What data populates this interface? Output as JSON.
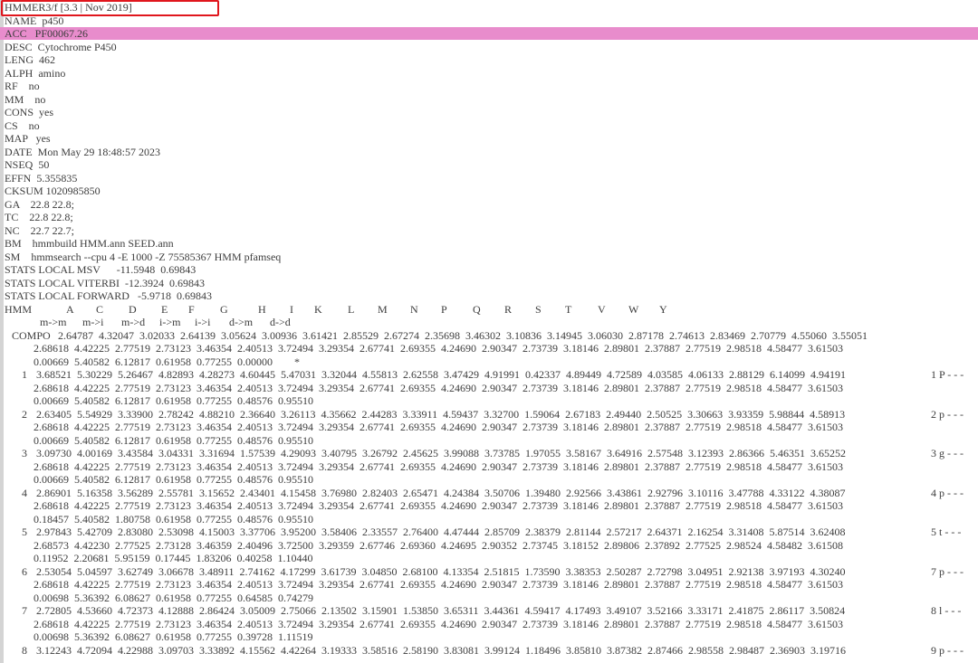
{
  "header": {
    "version_line": "HMMER3/f [3.3 | Nov 2019]",
    "fields": [
      "NAME  p450",
      "ACC   PF00067.26",
      "DESC  Cytochrome P450",
      "LENG  462",
      "ALPH  amino",
      "RF    no",
      "MM    no",
      "CONS  yes",
      "CS    no",
      "MAP   yes",
      "DATE  Mon May 29 18:48:57 2023",
      "NSEQ  50",
      "EFFN  5.355835",
      "CKSUM 1020985850",
      "GA    22.8 22.8;",
      "TC    22.8 22.8;",
      "NC    22.7 22.7;",
      "BM    hmmbuild HMM.ann SEED.ann",
      "SM    hmmsearch --cpu 4 -E 1000 -Z 75585367 HMM pfamseq",
      "STATS LOCAL MSV      -11.5948  0.69843",
      "STATS LOCAL VITERBI  -12.3924  0.69843",
      "STATS LOCAL FORWARD   -5.9718  0.69843"
    ],
    "highlighted_index": 1
  },
  "hmm": {
    "label": "HMM",
    "alphabet": [
      "A",
      "C",
      "D",
      "E",
      "F",
      "G",
      "H",
      "I",
      "K",
      "L",
      "M",
      "N",
      "P",
      "Q",
      "R",
      "S",
      "T",
      "V",
      "W",
      "Y"
    ],
    "transitions": [
      "m->m",
      "m->i",
      "m->d",
      "i->m",
      "i->i",
      "d->m",
      "d->d"
    ],
    "compo": {
      "label": "COMPO",
      "match": "2.64787  4.32047  3.02033  2.64139  3.05624  3.00936  3.61421  2.85529  2.67274  2.35698  3.46302  3.10836  3.14945  3.06030  2.87178  2.74613  2.83469  2.70779  4.55060  3.55051",
      "insert": "2.68618  4.42225  2.77519  2.73123  3.46354  2.40513  3.72494  3.29354  2.67741  2.69355  4.24690  2.90347  2.73739  3.18146  2.89801  2.37887  2.77519  2.98518  4.58477  3.61503",
      "trans": "0.00669  5.40582  6.12817  0.61958  0.77255  0.00000        *"
    },
    "states": [
      {
        "index": "1",
        "match": "3.68521  5.30229  5.26467  4.82893  4.28273  4.60445  5.47031  3.32044  4.55813  2.62558  3.47429  4.91991  0.42337  4.89449  4.72589  4.03585  4.06133  2.88129  6.14099  4.94191",
        "annot": "1 P - - -",
        "insert": "2.68618  4.42225  2.77519  2.73123  3.46354  2.40513  3.72494  3.29354  2.67741  2.69355  4.24690  2.90347  2.73739  3.18146  2.89801  2.37887  2.77519  2.98518  4.58477  3.61503",
        "trans": "0.00669  5.40582  6.12817  0.61958  0.77255  0.48576  0.95510"
      },
      {
        "index": "2",
        "match": "2.63405  5.54929  3.33900  2.78242  4.88210  2.36640  3.26113  4.35662  2.44283  3.33911  4.59437  3.32700  1.59064  2.67183  2.49440  2.50525  3.30663  3.93359  5.98844  4.58913",
        "annot": "2 p - - -",
        "insert": "2.68618  4.42225  2.77519  2.73123  3.46354  2.40513  3.72494  3.29354  2.67741  2.69355  4.24690  2.90347  2.73739  3.18146  2.89801  2.37887  2.77519  2.98518  4.58477  3.61503",
        "trans": "0.00669  5.40582  6.12817  0.61958  0.77255  0.48576  0.95510"
      },
      {
        "index": "3",
        "match": "3.09730  4.00169  3.43584  3.04331  3.31694  1.57539  4.29093  3.40795  3.26792  2.45625  3.99088  3.73785  1.97055  3.58167  3.64916  2.57548  3.12393  2.86366  5.46351  3.65252",
        "annot": "3 g - - -",
        "insert": "2.68618  4.42225  2.77519  2.73123  3.46354  2.40513  3.72494  3.29354  2.67741  2.69355  4.24690  2.90347  2.73739  3.18146  2.89801  2.37887  2.77519  2.98518  4.58477  3.61503",
        "trans": "0.00669  5.40582  6.12817  0.61958  0.77255  0.48576  0.95510"
      },
      {
        "index": "4",
        "match": "2.86901  5.16358  3.56289  2.55781  3.15652  2.43401  4.15458  3.76980  2.82403  2.65471  4.24384  3.50706  1.39480  2.92566  3.43861  2.92796  3.10116  3.47788  4.33122  4.38087",
        "annot": "4 p - - -",
        "insert": "2.68618  4.42225  2.77519  2.73123  3.46354  2.40513  3.72494  3.29354  2.67741  2.69355  4.24690  2.90347  2.73739  3.18146  2.89801  2.37887  2.77519  2.98518  4.58477  3.61503",
        "trans": "0.18457  5.40582  1.80758  0.61958  0.77255  0.48576  0.95510"
      },
      {
        "index": "5",
        "match": "2.97843  5.42709  2.83080  2.53098  4.15003  3.37706  3.95200  3.58406  2.33557  2.76400  4.47444  2.85709  2.38379  2.81144  2.57217  2.64371  2.16254  3.31408  5.87514  3.62408",
        "annot": "5 t - - -",
        "insert": "2.68573  4.42230  2.77525  2.73128  3.46359  2.40496  3.72500  3.29359  2.67746  2.69360  4.24695  2.90352  2.73745  3.18152  2.89806  2.37892  2.77525  2.98524  4.58482  3.61508",
        "trans": "0.11952  2.20681  5.95159  0.17445  1.83206  0.40258  1.10440"
      },
      {
        "index": "6",
        "match": "2.53054  5.04597  3.62749  3.06678  3.48911  2.74162  4.17299  3.61739  3.04850  2.68100  4.13354  2.51815  1.73590  3.38353  2.50287  2.72798  3.04951  2.92138  3.97193  4.30240",
        "annot": "7 p - - -",
        "insert": "2.68618  4.42225  2.77519  2.73123  3.46354  2.40513  3.72494  3.29354  2.67741  2.69355  4.24690  2.90347  2.73739  3.18146  2.89801  2.37887  2.77519  2.98518  4.58477  3.61503",
        "trans": "0.00698  5.36392  6.08627  0.61958  0.77255  0.64585  0.74279"
      },
      {
        "index": "7",
        "match": "2.72805  4.53660  4.72373  4.12888  2.86424  3.05009  2.75066  2.13502  3.15901  1.53850  3.65311  3.44361  4.59417  4.17493  3.49107  3.52166  3.33171  2.41875  2.86117  3.50824",
        "annot": "8 l - - -",
        "insert": "2.68618  4.42225  2.77519  2.73123  3.46354  2.40513  3.72494  3.29354  2.67741  2.69355  4.24690  2.90347  2.73739  3.18146  2.89801  2.37887  2.77519  2.98518  4.58477  3.61503",
        "trans": "0.00698  5.36392  6.08627  0.61958  0.77255  0.39728  1.11519"
      },
      {
        "index": "8",
        "match": "3.12243  4.72094  4.22988  3.09703  3.33892  4.15562  4.42264  3.19333  3.58516  2.58190  3.83081  3.99124  1.18496  3.85810  3.87382  2.87466  2.98558  2.98487  2.36903  3.19716",
        "annot": "9 p - - -"
      }
    ]
  }
}
